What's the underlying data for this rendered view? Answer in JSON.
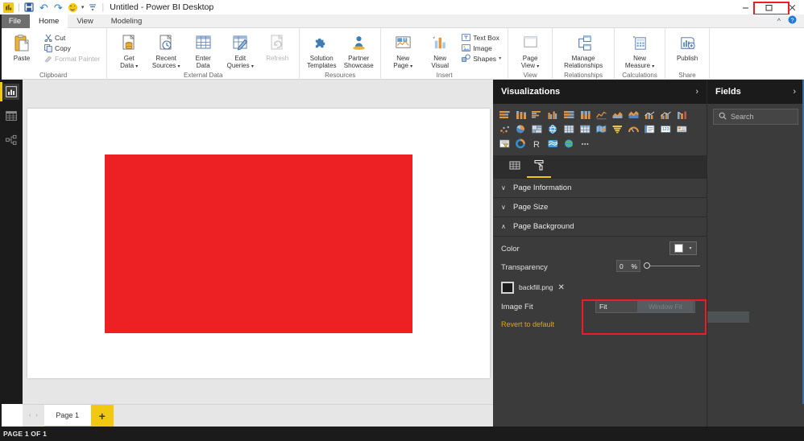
{
  "window": {
    "title": "Untitled - Power BI Desktop",
    "app_icon": "power-bi-logo-icon",
    "quick_access": [
      {
        "name": "save-icon",
        "label": "Save"
      },
      {
        "name": "undo-icon",
        "label": "Undo"
      },
      {
        "name": "redo-icon",
        "label": "Redo"
      },
      {
        "name": "smiley-feedback-icon",
        "label": "Send a Smile"
      },
      {
        "name": "customize-qat-icon",
        "label": "Customize Quick Access Toolbar"
      }
    ],
    "controls": {
      "minimize": "–",
      "maximize": "☐",
      "close": "✕",
      "collapse_ribbon": "˄",
      "help": "?"
    }
  },
  "ribbon": {
    "tabs": [
      {
        "label": "File",
        "active": false,
        "file": true
      },
      {
        "label": "Home",
        "active": true,
        "file": false
      },
      {
        "label": "View",
        "active": false,
        "file": false
      },
      {
        "label": "Modeling",
        "active": false,
        "file": false
      }
    ],
    "groups": [
      {
        "title": "Clipboard",
        "big": [
          {
            "label": "Paste",
            "icon": "paste-icon",
            "disabled": false
          }
        ],
        "small": [
          {
            "label": "Cut",
            "icon": "cut-icon",
            "disabled": false
          },
          {
            "label": "Copy",
            "icon": "copy-icon",
            "disabled": false
          },
          {
            "label": "Format Painter",
            "icon": "format-painter-icon",
            "disabled": true
          }
        ]
      },
      {
        "title": "External Data",
        "big": [
          {
            "label": "Get\nData",
            "icon": "get-data-icon",
            "disabled": false,
            "dropdown": true
          },
          {
            "label": "Recent\nSources",
            "icon": "recent-sources-icon",
            "disabled": false,
            "dropdown": true
          },
          {
            "label": "Enter\nData",
            "icon": "enter-data-icon",
            "disabled": false,
            "dropdown": false
          },
          {
            "label": "Edit\nQueries",
            "icon": "edit-queries-icon",
            "disabled": false,
            "dropdown": true
          },
          {
            "label": "Refresh",
            "icon": "refresh-icon",
            "disabled": true,
            "dropdown": false
          }
        ],
        "small": []
      },
      {
        "title": "Resources",
        "big": [
          {
            "label": "Solution\nTemplates",
            "icon": "solution-templates-icon",
            "disabled": false,
            "dropdown": false
          },
          {
            "label": "Partner\nShowcase",
            "icon": "partner-showcase-icon",
            "disabled": false,
            "dropdown": false
          }
        ],
        "small": []
      },
      {
        "title": "Insert",
        "big": [
          {
            "label": "New\nPage",
            "icon": "new-page-icon",
            "disabled": false,
            "dropdown": true
          },
          {
            "label": "New\nVisual",
            "icon": "new-visual-icon",
            "disabled": false,
            "dropdown": false
          }
        ],
        "small": [
          {
            "label": "Text Box",
            "icon": "text-box-icon",
            "disabled": false
          },
          {
            "label": "Image",
            "icon": "image-icon",
            "disabled": false
          },
          {
            "label": "Shapes",
            "icon": "shapes-icon",
            "disabled": false,
            "dropdown": true
          }
        ]
      },
      {
        "title": "View",
        "big": [
          {
            "label": "Page\nView",
            "icon": "page-view-icon",
            "disabled": false,
            "dropdown": true
          }
        ],
        "small": []
      },
      {
        "title": "Relationships",
        "big": [
          {
            "label": "Manage\nRelationships",
            "icon": "manage-relationships-icon",
            "disabled": false,
            "dropdown": false
          }
        ],
        "small": []
      },
      {
        "title": "Calculations",
        "big": [
          {
            "label": "New\nMeasure",
            "icon": "new-measure-icon",
            "disabled": false,
            "dropdown": true
          }
        ],
        "small": []
      },
      {
        "title": "Share",
        "big": [
          {
            "label": "Publish",
            "icon": "publish-icon",
            "disabled": false,
            "dropdown": false
          }
        ],
        "small": []
      }
    ]
  },
  "viewbar": {
    "items": [
      {
        "name": "report-view",
        "icon": "bar-chart-icon",
        "selected": true
      },
      {
        "name": "data-view",
        "icon": "table-grid-icon",
        "selected": false
      },
      {
        "name": "model-view",
        "icon": "relationships-icon",
        "selected": false
      }
    ]
  },
  "canvas": {
    "background_image_color": "#ED2024",
    "background_image_name": "backfill.png"
  },
  "pages": {
    "prev_arrow": "‹",
    "next_arrow": "›",
    "tabs": [
      {
        "label": "Page 1",
        "active": true
      }
    ],
    "add_label": "+"
  },
  "statusbar": {
    "text": "PAGE 1 OF 1"
  },
  "visualizations": {
    "header": "Visualizations",
    "header_chevron": "›",
    "icons": [
      "stacked-bar-chart-icon",
      "stacked-column-chart-icon",
      "clustered-bar-chart-icon",
      "clustered-column-chart-icon",
      "100-stacked-bar-chart-icon",
      "100-stacked-column-chart-icon",
      "line-chart-icon",
      "area-chart-icon",
      "stacked-area-chart-icon",
      "line-stacked-column-chart-icon",
      "line-clustered-column-chart-icon",
      "ribbon-chart-icon",
      "scatter-chart-icon",
      "pie-chart-icon",
      "treemap-icon",
      "map-icon",
      "table-icon",
      "matrix-icon",
      "filled-map-icon",
      "funnel-icon",
      "gauge-icon",
      "card-icon",
      "multi-row-card-icon",
      "kpi-icon",
      "slicer-icon",
      "donut-chart-icon",
      "r-script-visual-icon",
      "arcgis-maps-icon",
      "globe-map-icon",
      "more-options-icon"
    ],
    "format_tabs": [
      {
        "name": "fields-tab",
        "icon": "fields-grid-icon",
        "selected": false
      },
      {
        "name": "format-tab",
        "icon": "paint-roller-icon",
        "selected": true
      }
    ],
    "sections": [
      {
        "name": "page-information",
        "label": "Page Information",
        "expanded": false,
        "chevron": "∨"
      },
      {
        "name": "page-size",
        "label": "Page Size",
        "expanded": false,
        "chevron": "∨"
      },
      {
        "name": "page-background",
        "label": "Page Background",
        "expanded": true,
        "chevron": "∧"
      }
    ],
    "page_background": {
      "color_label": "Color",
      "color_value": "#FFFFFF",
      "color_caret": "▾",
      "transparency_label": "Transparency",
      "transparency_value": "0",
      "transparency_unit": "%",
      "file_name": "backfill.png",
      "file_remove": "✕",
      "image_fit_label": "Image Fit",
      "image_fit_value": "Fit",
      "image_fit_caret": "▾",
      "image_fit_ghost_option": "Window Fit",
      "revert_label": "Revert to default"
    }
  },
  "fields": {
    "header": "Fields",
    "header_chevron": "›",
    "search_placeholder": "Search",
    "search_icon": "search-icon"
  },
  "annotations": {
    "accent_color": "#EE1C25",
    "maximize_highlight": "red-box-around-maximize-button",
    "image_fit_highlight": "red-box-around-image-fit-dropdown",
    "arrow": "red-arrow-to-maximize"
  }
}
